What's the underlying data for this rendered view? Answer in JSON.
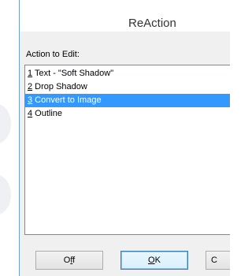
{
  "window": {
    "title": "ReAction"
  },
  "action_section": {
    "label": "Action to Edit:",
    "items": [
      {
        "number": "1",
        "text": " Text - \"Soft Shadow\"",
        "selected": false
      },
      {
        "number": "2",
        "text": " Drop Shadow",
        "selected": false
      },
      {
        "number": "3",
        "text": " Convert to Image",
        "selected": true
      },
      {
        "number": "4",
        "text": " Outline",
        "selected": false
      }
    ]
  },
  "buttons": {
    "off_prefix": "O",
    "off_underlined": "f",
    "off_suffix": "f",
    "ok_underlined": "O",
    "ok_suffix": "K",
    "cancel_partial": "C"
  },
  "colors": {
    "selection": "#3399ff",
    "window_border": "#6f9ed6"
  }
}
